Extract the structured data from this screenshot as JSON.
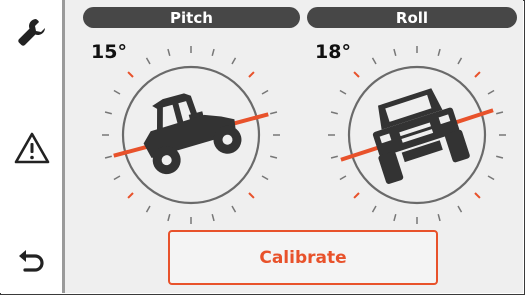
{
  "sidebar": {
    "items": [
      {
        "icon": "wrench-icon"
      },
      {
        "icon": "warning-icon"
      },
      {
        "icon": "back-arrow-icon"
      }
    ]
  },
  "gauges": {
    "pitch": {
      "label": "Pitch",
      "value": "15°",
      "angle_deg": 15
    },
    "roll": {
      "label": "Roll",
      "value": "18°",
      "angle_deg": 18
    }
  },
  "calibrate_label": "Calibrate",
  "colors": {
    "accent": "#e8522b",
    "pill_background": "#474747",
    "panel_background": "#efefef"
  }
}
